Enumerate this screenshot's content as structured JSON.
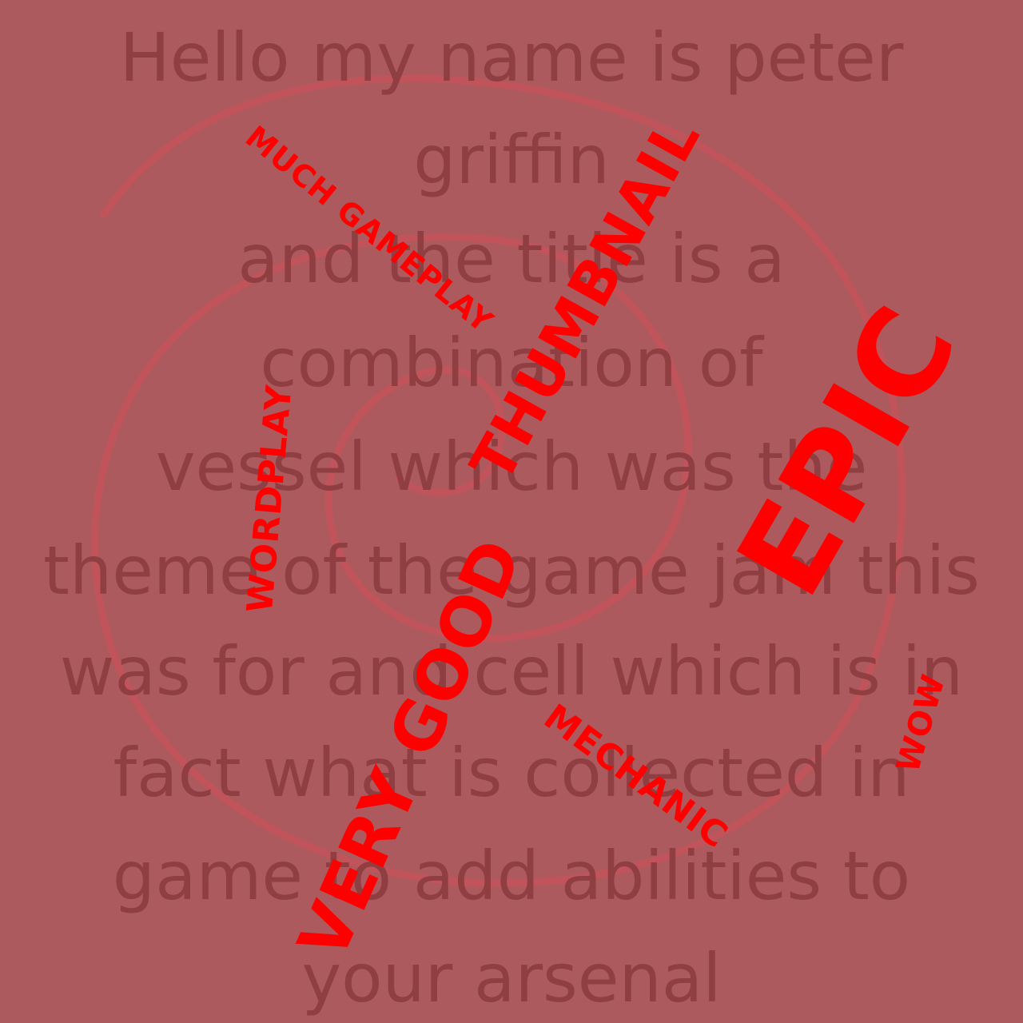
{
  "background_color": "#ad5a5e",
  "text_color": "#8f3e42",
  "accent_color": "#ff0000",
  "paragraph": [
    "Hello my  name is peter",
    "griffin",
    "and the title is a",
    "combination of",
    "vessel which was the",
    "theme of the game jam this",
    "was for and cell which is in",
    "fact what is collected in",
    "game to add abilities to",
    "your arsenal"
  ],
  "stickers": {
    "much_gameplay": "MUCH GAMEPLAY",
    "wordplay": "WORDPLAY",
    "thumbnail": "THUMBNAIL",
    "epic": "EPIC",
    "very_good": "VERY GOOD",
    "mechanic": "MECHANIC",
    "wow": "WOW"
  }
}
